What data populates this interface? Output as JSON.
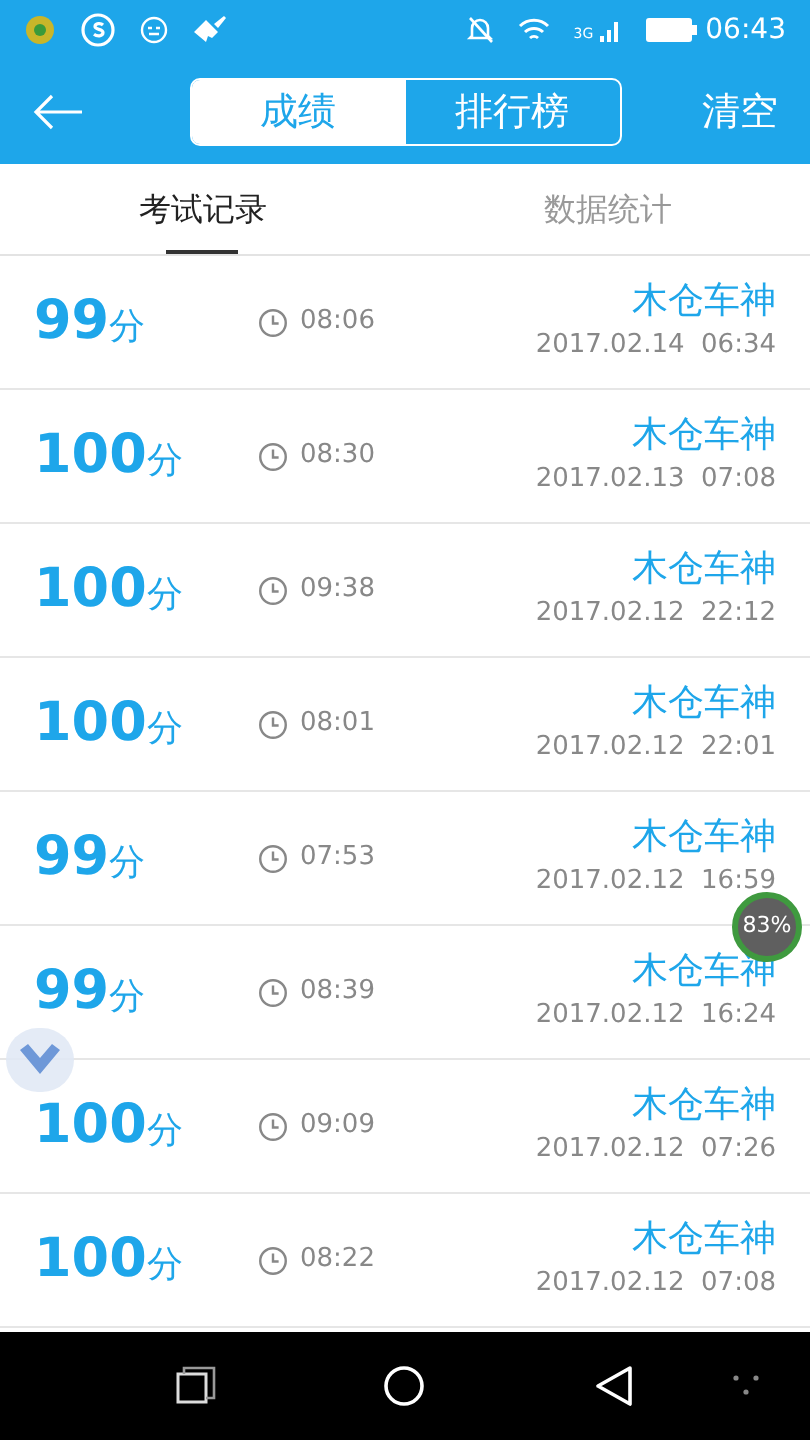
{
  "status_bar": {
    "network": "3G",
    "time": "06:43"
  },
  "header": {
    "segments": [
      {
        "label": "成绩",
        "selected": true
      },
      {
        "label": "排行榜",
        "selected": false
      }
    ],
    "action": "清空"
  },
  "tabs": [
    {
      "label": "考试记录",
      "selected": true
    },
    {
      "label": "数据统计",
      "selected": false
    }
  ],
  "records": [
    {
      "score": "99",
      "unit": "分",
      "duration": "08:06",
      "name": "木仓车神",
      "date": "2017.02.14  06:34"
    },
    {
      "score": "100",
      "unit": "分",
      "duration": "08:30",
      "name": "木仓车神",
      "date": "2017.02.13  07:08"
    },
    {
      "score": "100",
      "unit": "分",
      "duration": "09:38",
      "name": "木仓车神",
      "date": "2017.02.12  22:12"
    },
    {
      "score": "100",
      "unit": "分",
      "duration": "08:01",
      "name": "木仓车神",
      "date": "2017.02.12  22:01"
    },
    {
      "score": "99",
      "unit": "分",
      "duration": "07:53",
      "name": "木仓车神",
      "date": "2017.02.12  16:59"
    },
    {
      "score": "99",
      "unit": "分",
      "duration": "08:39",
      "name": "木仓车神",
      "date": "2017.02.12  16:24"
    },
    {
      "score": "100",
      "unit": "分",
      "duration": "09:09",
      "name": "木仓车神",
      "date": "2017.02.12  07:26"
    },
    {
      "score": "100",
      "unit": "分",
      "duration": "08:22",
      "name": "木仓车神",
      "date": "2017.02.12  07:08"
    }
  ],
  "floating_badge": {
    "text": "83%"
  }
}
